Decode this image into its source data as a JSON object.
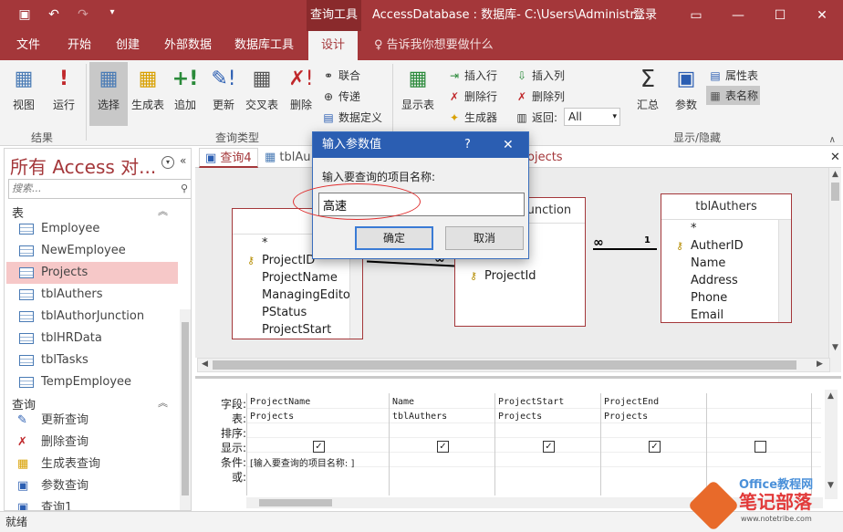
{
  "titlebar": {
    "context_tab": "查询工具",
    "title": "AccessDatabase : 数据库- C:\\Users\\Administr...",
    "login": "登录",
    "qat_icons": [
      "save-icon",
      "undo-icon",
      "redo-icon",
      "customize-icon"
    ]
  },
  "tabs": {
    "file": "文件",
    "home": "开始",
    "create": "创建",
    "external": "外部数据",
    "dbtools": "数据库工具",
    "design": "设计",
    "tellme": "告诉我你想要做什么"
  },
  "ribbon": {
    "view": "视图",
    "run": "运行",
    "select": "选择",
    "make_table": "生成表",
    "append": "追加",
    "update": "更新",
    "crosstab": "交叉表",
    "delete": "删除",
    "union": "联合",
    "passthrough": "传递",
    "data_definition": "数据定义",
    "show_table": "显示表",
    "insert_row": "插入行",
    "delete_row": "删除行",
    "builder": "生成器",
    "insert_col": "插入列",
    "delete_col": "删除列",
    "return_label": "返回:",
    "return_value": "All",
    "totals": "汇总",
    "parameters": "参数",
    "property_sheet": "属性表",
    "table_names": "表名称",
    "group_results": "结果",
    "group_query_type": "查询类型",
    "group_show_hide": "显示/隐藏"
  },
  "nav": {
    "title": "所有 Access 对...",
    "search_placeholder": "搜索...",
    "tables_header": "表",
    "tables": [
      "Employee",
      "NewEmployee",
      "Projects",
      "tblAuthers",
      "tblAuthorJunction",
      "tblHRData",
      "tblTasks",
      "TempEmployee"
    ],
    "selected_table": "Projects",
    "queries_header": "查询",
    "queries": [
      "更新查询",
      "删除查询",
      "生成表查询",
      "参数查询",
      "查询1"
    ]
  },
  "doctabs": [
    "查询4",
    "tblAu",
    "ojects"
  ],
  "design": {
    "projects": {
      "title": "Projec",
      "fields": [
        "*",
        "ProjectID",
        "ProjectName",
        "ManagingEditor",
        "PStatus",
        "ProjectStart"
      ]
    },
    "junction": {
      "title": "Junction",
      "fields": [
        "ProjectId"
      ]
    },
    "authers": {
      "title": "tblAuthers",
      "fields": [
        "*",
        "AutherID",
        "Name",
        "Address",
        "Phone",
        "Email"
      ]
    },
    "rel_symbols": [
      "∞",
      "1",
      "∞"
    ]
  },
  "grid": {
    "row_labels": [
      "字段:",
      "表:",
      "排序:",
      "显示:",
      "条件:",
      "或:"
    ],
    "columns": [
      {
        "field": "ProjectName",
        "table": "Projects",
        "show": true,
        "criteria": "[输入要查询的项目名称: ]"
      },
      {
        "field": "Name",
        "table": "tblAuthers",
        "show": true,
        "criteria": ""
      },
      {
        "field": "ProjectStart",
        "table": "Projects",
        "show": true,
        "criteria": ""
      },
      {
        "field": "ProjectEnd",
        "table": "Projects",
        "show": true,
        "criteria": ""
      },
      {
        "field": "",
        "table": "",
        "show": false,
        "criteria": ""
      }
    ]
  },
  "status": "就绪",
  "dialog": {
    "title": "输入参数值",
    "help": "?",
    "prompt": "输入要查询的项目名称:",
    "value": "高速",
    "ok": "确定",
    "cancel": "取消"
  },
  "watermark": {
    "logo": "Office教程网",
    "text": "笔记部落",
    "url": "www.notetribe.com"
  }
}
